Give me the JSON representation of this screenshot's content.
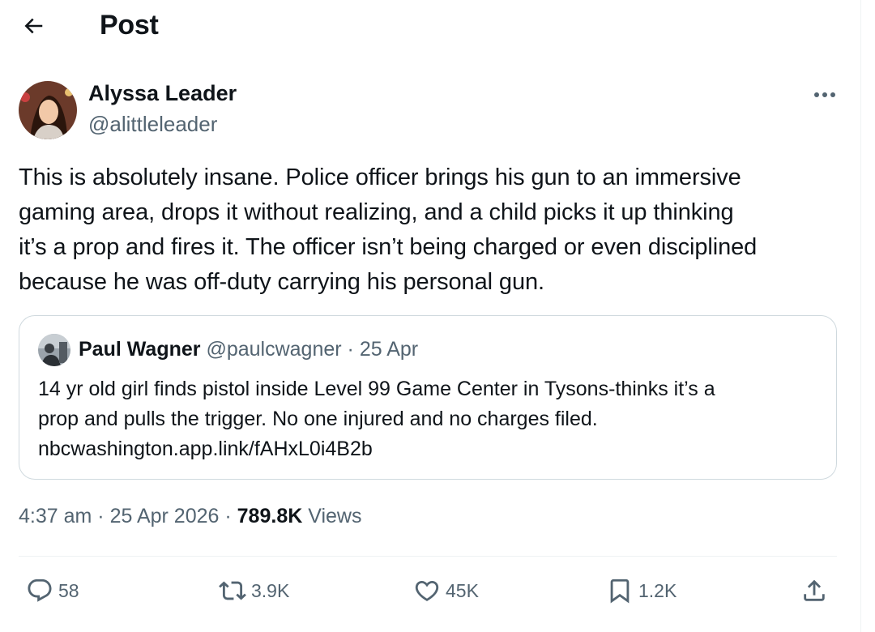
{
  "header": {
    "title": "Post"
  },
  "author": {
    "name": "Alyssa Leader",
    "handle": "@alittleleader"
  },
  "tweet": {
    "lines": [
      "This is absolutely insane. Police officer brings his gun to an immersive",
      "gaming area, drops it without realizing, and a child picks it up thinking",
      "it’s a prop and fires it. The officer isn’t being charged or even disciplined",
      "because he was off-duty carrying his personal gun."
    ]
  },
  "quote": {
    "name": "Paul Wagner",
    "handle": "@paulcwagner",
    "separator": "·",
    "date": "25 Apr",
    "lines": [
      "14 yr old girl finds pistol inside Level 99 Game Center in Tysons-thinks it’s a",
      "prop and pulls the trigger. No one injured and no charges filed.",
      "nbcwashington.app.link/fAHxL0i4B2b"
    ]
  },
  "meta": {
    "time": "4:37 am",
    "separator": "·",
    "date": "25 Apr 2026",
    "views_count": "789.8K",
    "views_label": "Views"
  },
  "actions": {
    "replies": "58",
    "reposts": "3.9K",
    "likes": "45K",
    "bookmarks": "1.2K"
  },
  "colors": {
    "text": "#0f1419",
    "secondary": "#536471",
    "border": "#cfd9de"
  }
}
